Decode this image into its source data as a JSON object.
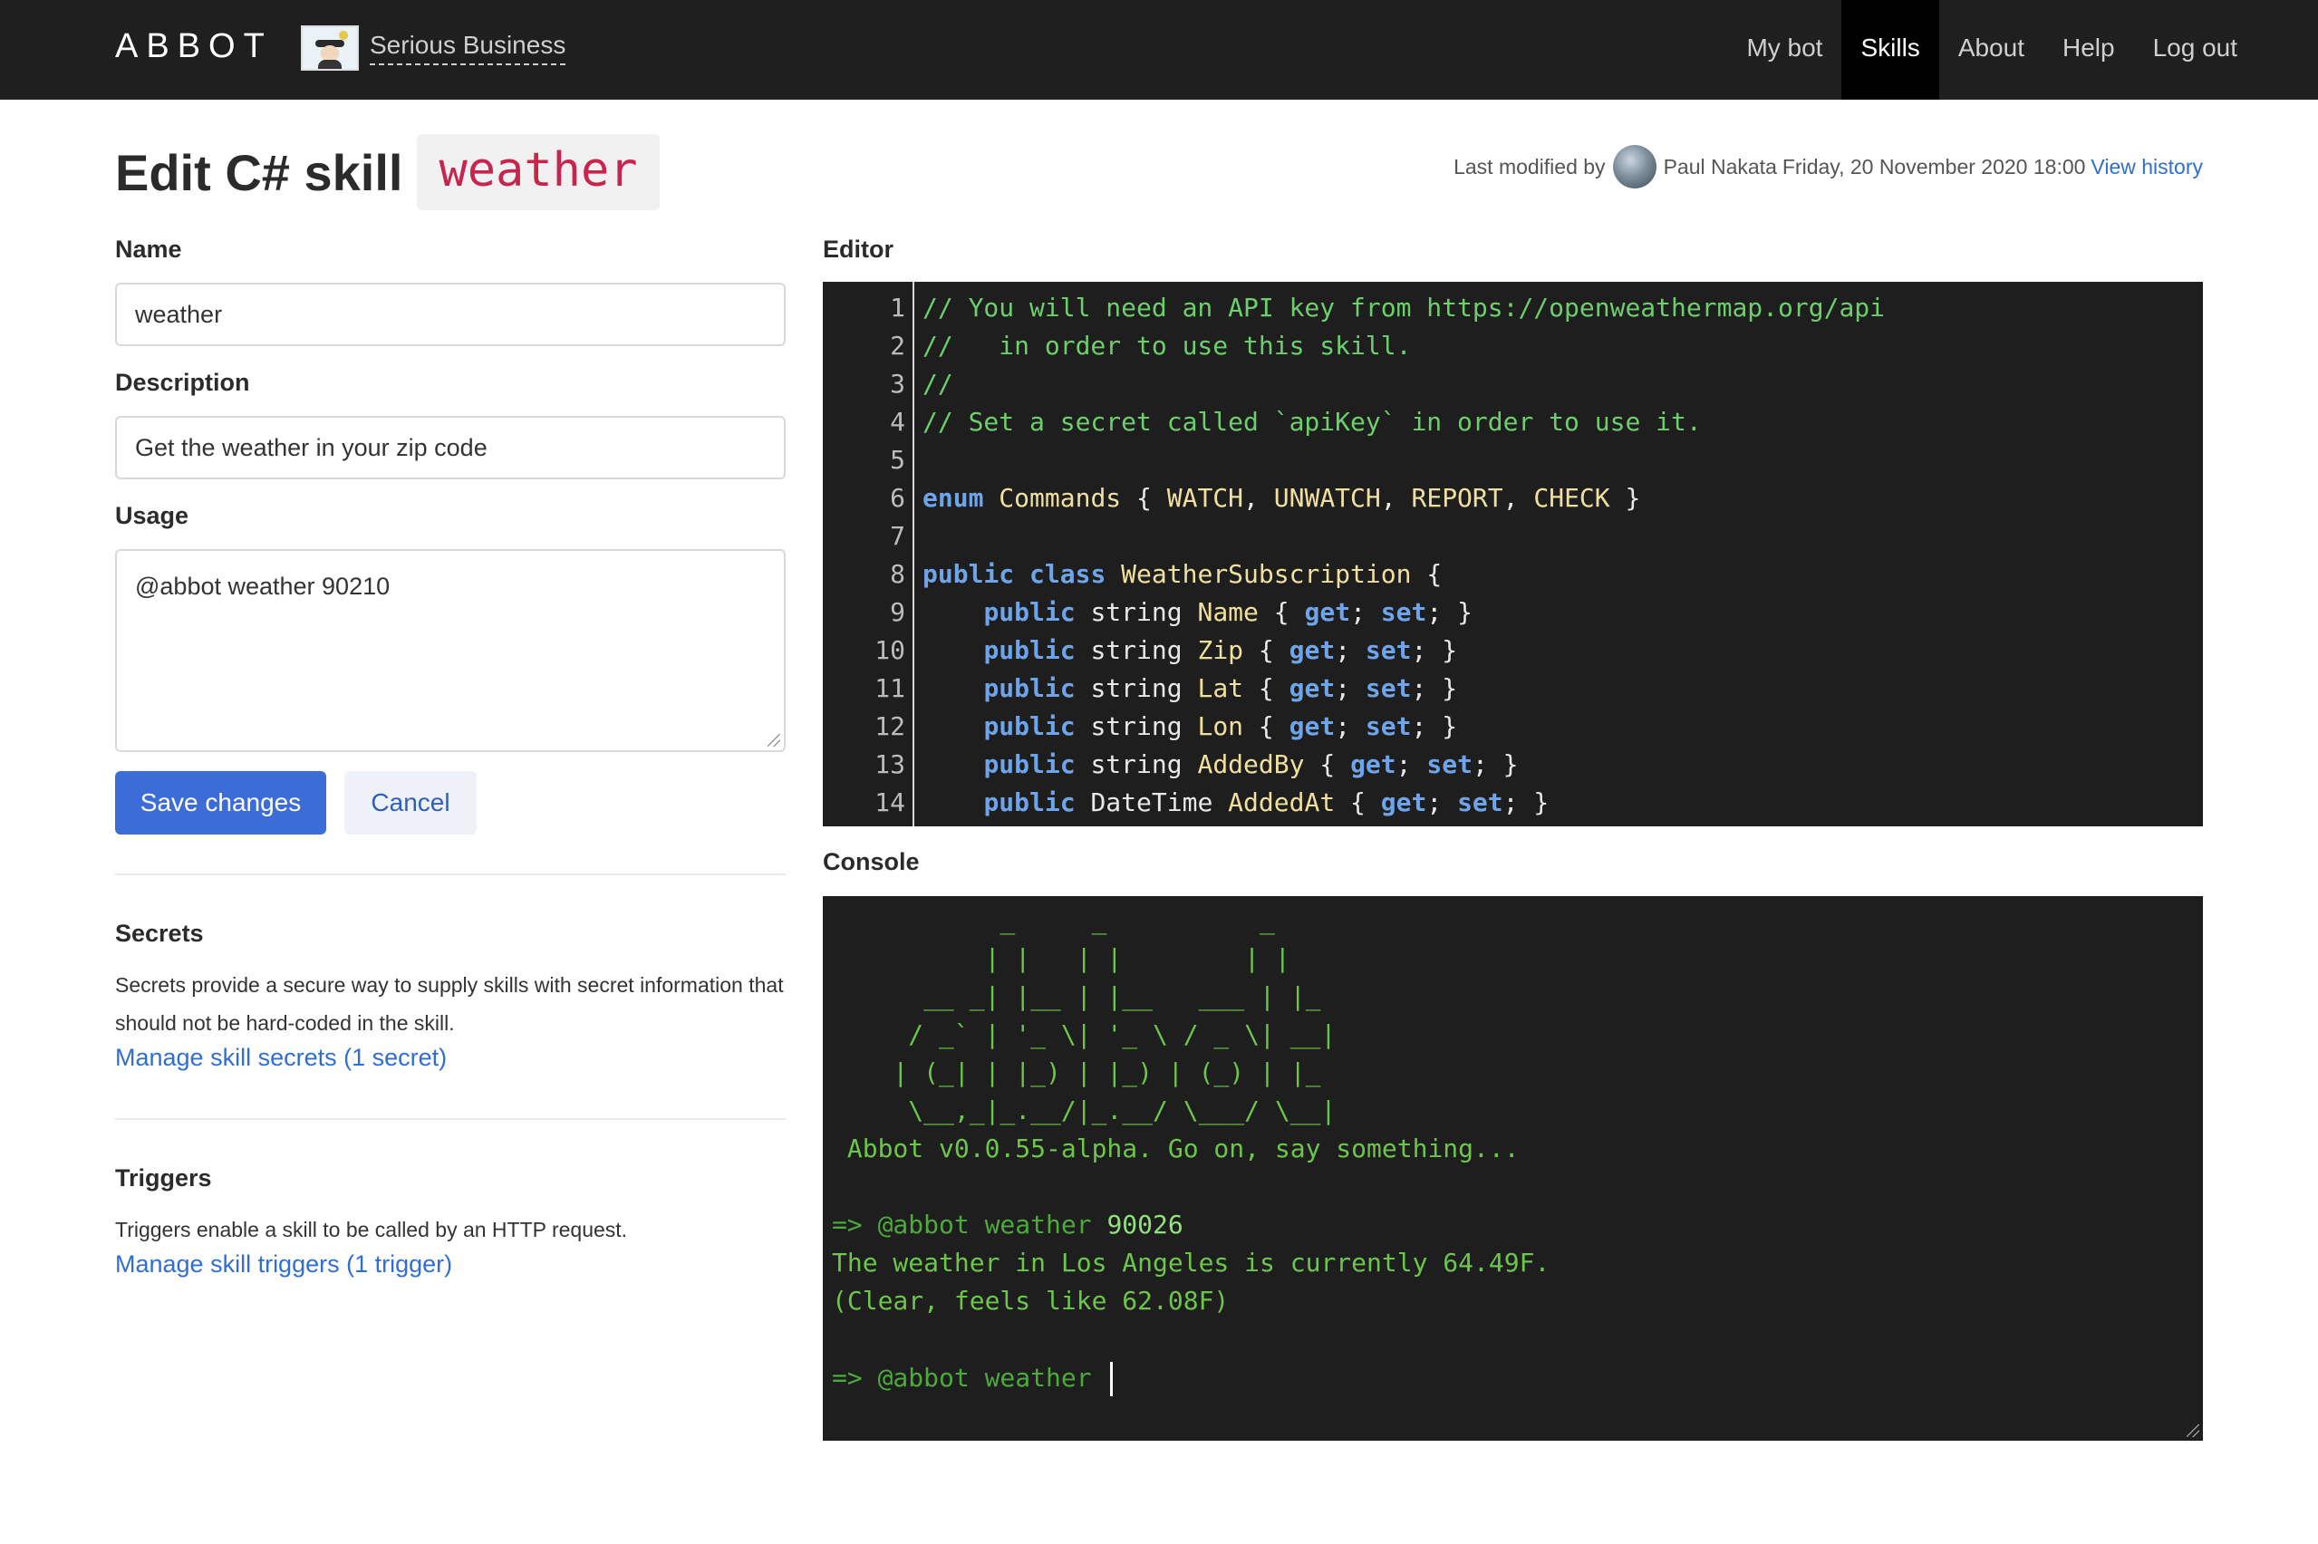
{
  "nav": {
    "brand": "ABBOT",
    "org_name": "Serious Business",
    "items": [
      {
        "label": "My bot",
        "active": false
      },
      {
        "label": "Skills",
        "active": true
      },
      {
        "label": "About",
        "active": false
      },
      {
        "label": "Help",
        "active": false
      },
      {
        "label": "Log out",
        "active": false
      }
    ]
  },
  "header": {
    "title": "Edit C# skill",
    "skill_name": "weather",
    "modified_prefix": "Last modified by",
    "modified_user": "Paul Nakata",
    "modified_date": "Friday, 20 November 2020 18:00",
    "history_link": "View history"
  },
  "form": {
    "name_label": "Name",
    "name_value": "weather",
    "description_label": "Description",
    "description_value": "Get the weather in your zip code",
    "usage_label": "Usage",
    "usage_value": "@abbot weather 90210",
    "save_label": "Save changes",
    "cancel_label": "Cancel"
  },
  "secrets": {
    "heading": "Secrets",
    "text": "Secrets provide a secure way to supply skills with secret information that should not be hard-coded in the skill.",
    "link": "Manage skill secrets (1 secret)"
  },
  "triggers": {
    "heading": "Triggers",
    "text": "Triggers enable a skill to be called by an HTTP request.",
    "link": "Manage skill triggers (1 trigger)"
  },
  "editor": {
    "label": "Editor",
    "line_numbers": [
      "1",
      "2",
      "3",
      "4",
      "5",
      "6",
      "7",
      "8",
      "9",
      "10",
      "11",
      "12",
      "13",
      "14"
    ],
    "lines": {
      "l1": "// You will need an API key from https://openweathermap.org/api",
      "l2": "//   in order to use this skill.",
      "l3": "//",
      "l4": "// Set a secret called `apiKey` in order to use it.",
      "l6_kw": "enum",
      "l6_name": "Commands",
      "l6_open": "{",
      "l6_values": [
        "WATCH",
        "UNWATCH",
        "REPORT",
        "CHECK"
      ],
      "l6_close": "}",
      "l8_kw1": "public",
      "l8_kw2": "class",
      "l8_name": "WeatherSubscription",
      "l8_open": "{",
      "props": [
        {
          "type": "string",
          "name": "Name"
        },
        {
          "type": "string",
          "name": "Zip"
        },
        {
          "type": "string",
          "name": "Lat"
        },
        {
          "type": "string",
          "name": "Lon"
        },
        {
          "type": "string",
          "name": "AddedBy"
        },
        {
          "type": "DateTime",
          "name": "AddedAt"
        }
      ],
      "prop_kw": "public",
      "get_kw": "get",
      "set_kw": "set"
    }
  },
  "console": {
    "label": "Console",
    "ascii": [
      "           _     _          _   ",
      "          | |   | |        | |  ",
      "      __ _| |__ | |__   ___ | |_ ",
      "     / _` | '_ \\| '_ \\ / _ \\| __|",
      "    | (_| | |_) | |_) | (_) | |_ ",
      "     \\__,_|_.__/|_.__/ \\___/ \\__|"
    ],
    "banner": " Abbot v0.0.55-alpha. Go on, say something...",
    "cmd1_prefix": "=> @abbot weather ",
    "cmd1_arg": "90026",
    "response1": "The weather in Los Angeles is currently 64.49F.",
    "response2": "(Clear, feels like 62.08F)",
    "cmd2": "=> @abbot weather "
  }
}
